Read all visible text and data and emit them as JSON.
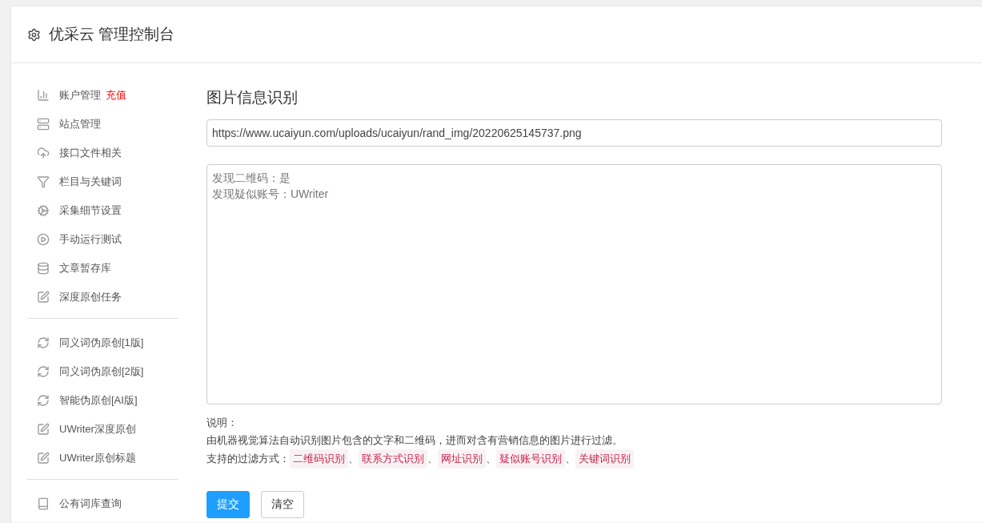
{
  "header": {
    "title": "优采云 管理控制台"
  },
  "sidebar": {
    "groups": [
      {
        "items": [
          {
            "kind": "chart",
            "label": "账户管理",
            "badge": "充值"
          },
          {
            "kind": "server",
            "label": "站点管理"
          },
          {
            "kind": "upload",
            "label": "接口文件相关"
          },
          {
            "kind": "filter",
            "label": "栏目与关键词"
          },
          {
            "kind": "gears",
            "label": "采集细节设置"
          },
          {
            "kind": "play",
            "label": "手动运行测试"
          },
          {
            "kind": "database",
            "label": "文章暂存库"
          },
          {
            "kind": "edit",
            "label": "深度原创任务"
          }
        ]
      },
      {
        "items": [
          {
            "kind": "refresh",
            "label": "同义词伪原创[1版]"
          },
          {
            "kind": "refresh",
            "label": "同义词伪原创[2版]"
          },
          {
            "kind": "refresh",
            "label": "智能伪原创[AI版]"
          },
          {
            "kind": "edit",
            "label": "UWriter深度原创"
          },
          {
            "kind": "edit",
            "label": "UWriter原创标题"
          }
        ]
      },
      {
        "items": [
          {
            "kind": "book",
            "label": "公有词库查询"
          }
        ]
      }
    ]
  },
  "main": {
    "title": "图片信息识别",
    "url_field": {
      "value": "https://www.ucaiyun.com/uploads/ucaiyun/rand_img/20220625145737.png"
    },
    "result": {
      "lines": [
        "发现二维码：是",
        "发现疑似账号：UWriter"
      ]
    },
    "note_heading": "说明：",
    "note_text": "由机器视觉算法自动识别图片包含的文字和二维码，进而对含有营销信息的图片进行过滤。",
    "methods_label": "支持的过滤方式：",
    "methods": [
      "二维码识别",
      "联系方式识别",
      "网址识别",
      "疑似账号识别",
      "关键词识别"
    ],
    "separator": "、",
    "buttons": [
      {
        "kind": "primary",
        "label": "提交"
      },
      {
        "kind": "default",
        "label": "清空"
      }
    ]
  }
}
